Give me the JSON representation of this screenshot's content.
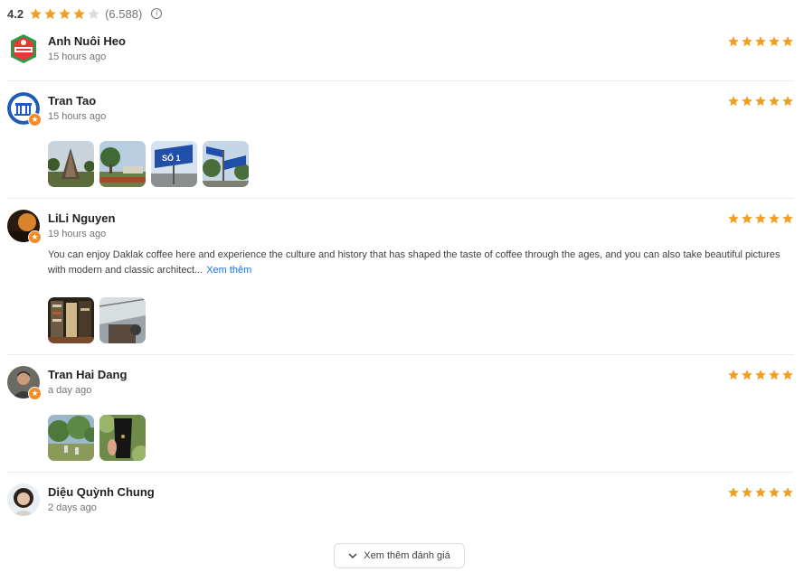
{
  "summary": {
    "score": "4.2",
    "stars": 4,
    "count": "(6.588)",
    "info_icon": "info-icon"
  },
  "reviews": [
    {
      "name": "Anh Nuôi Heo",
      "time": "15 hours ago",
      "stars": 5,
      "avatar_icon": "shop-logo-avatar",
      "text": "",
      "photos": []
    },
    {
      "name": "Tran Tao",
      "time": "15 hours ago",
      "stars": 5,
      "avatar_icon": "blue-building-avatar",
      "local_guide_icon": "local-guide-star-icon",
      "text": "",
      "photos": [
        "cone-monument-photo",
        "pine-garden-photo",
        "street-sign-photo",
        "street-sign-trees-photo"
      ]
    },
    {
      "name": "LiLi Nguyen",
      "time": "19 hours ago",
      "stars": 5,
      "avatar_icon": "sunset-avatar",
      "local_guide_icon": "local-guide-star-icon",
      "text": "You can enjoy Daklak coffee here and experience the culture and history that has shaped the taste of coffee through the ages, and you can also take beautiful pictures with modern and classic architect...",
      "more_link": "Xem thêm",
      "photos": [
        "bookshelf-photo",
        "interior-ceiling-photo"
      ]
    },
    {
      "name": "Tran Hai Dang",
      "time": "a day ago",
      "stars": 5,
      "avatar_icon": "person-avatar",
      "local_guide_icon": "local-guide-star-icon",
      "text": "",
      "photos": [
        "coffee-farm-photo",
        "coffee-cup-photo"
      ]
    },
    {
      "name": "Diệu Quỳnh Chung",
      "time": "2 days ago",
      "stars": 5,
      "avatar_icon": "woman-avatar",
      "text": "",
      "photos": []
    }
  ],
  "load_more": {
    "label": "Xem thêm đánh giá",
    "icon": "chevron-down-icon"
  },
  "colors": {
    "star": "#f0a020",
    "star_off": "#dadce0",
    "link": "#1a73e8",
    "badge": "#f28c28"
  }
}
